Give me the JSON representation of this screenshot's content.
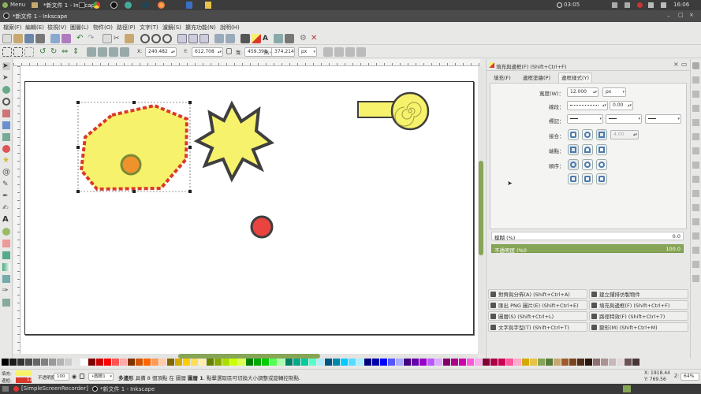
{
  "top_panel": {
    "menu_label": "Menu",
    "window_title": "*新文件 1 - Inkscape",
    "clock_left": "03:05",
    "clock_right": "16:06"
  },
  "menubar": {
    "items": [
      "檔案(F)",
      "編輯(E)",
      "檢視(V)",
      "圖層(L)",
      "物件(O)",
      "路徑(P)",
      "文字(T)",
      "濾鏡(S)",
      "擴充功能(N)",
      "說明(H)"
    ]
  },
  "tool_controls": {
    "x_label": "X:",
    "x_value": "240.482",
    "y_label": "Y:",
    "y_value": "612.708",
    "w_label": "寬:",
    "w_value": "459.398",
    "h_label": "高:",
    "h_value": "374.214",
    "unit": "px"
  },
  "dock": {
    "title": "填充與邊框(F) (Shift+Ctrl+F)",
    "tabs": [
      "填充(F)",
      "邊框塗繪(P)",
      "邊框樣式(Y)"
    ],
    "width_label": "寬度(W)：",
    "width_value": "12.000",
    "width_unit": "px",
    "dash_label": "線段：",
    "dash_offset": "0.00",
    "markers_label": "標記：",
    "join_label": "接合：",
    "miter_value": "4.00",
    "cap_label": "端點：",
    "order_label": "順序：",
    "blur_label": "模糊 (%)",
    "blur_value": "0.0",
    "opacity_label": "不透明度 (%0",
    "opacity_value": "100.0",
    "panels": [
      "對齊與分佈(A) (Shift+Ctrl+A)",
      "建立鋪排仿製物件",
      "匯出 PNG 圖片(E) (Shift+Ctrl+E)",
      "填充與邊框(F) (Shift+Ctrl+F)",
      "圖層(S) (Shift+Ctrl+L)",
      "路徑特效(F) (Shift+Ctrl+7)",
      "文字與字型(T) (Shift+Ctrl+T)",
      "變形(M) (Shift+Ctrl+M)"
    ]
  },
  "statusbar": {
    "fill_label": "填充:",
    "stroke_label": "邊框:",
    "stroke_width": "12",
    "opacity_label": "不透明度:",
    "opacity_value": "100",
    "layer": "•圖層1",
    "message_bold": "多邊形",
    "message": " 具備 8 個頂點 在 圖層 ",
    "message_layer": "圖層 1",
    "message_tail": ". 點擊選取區可切換大小調整或旋轉控制點.",
    "x_coord": "X: 1918.44",
    "y_coord": "Y: 769.56",
    "z_label": "Z:",
    "zoom": "64%"
  },
  "taskbar": {
    "items": [
      "[SimpleScreenRecorder]",
      "*新文件 1 - Inkscape"
    ]
  },
  "colors": {
    "accent": "#87a556",
    "canvas_yellow": "#f7f26b",
    "dash_red": "#d93a2b",
    "orange": "#f0922b",
    "red_circle": "#e94440",
    "dark_stroke": "#3f3f3f"
  }
}
